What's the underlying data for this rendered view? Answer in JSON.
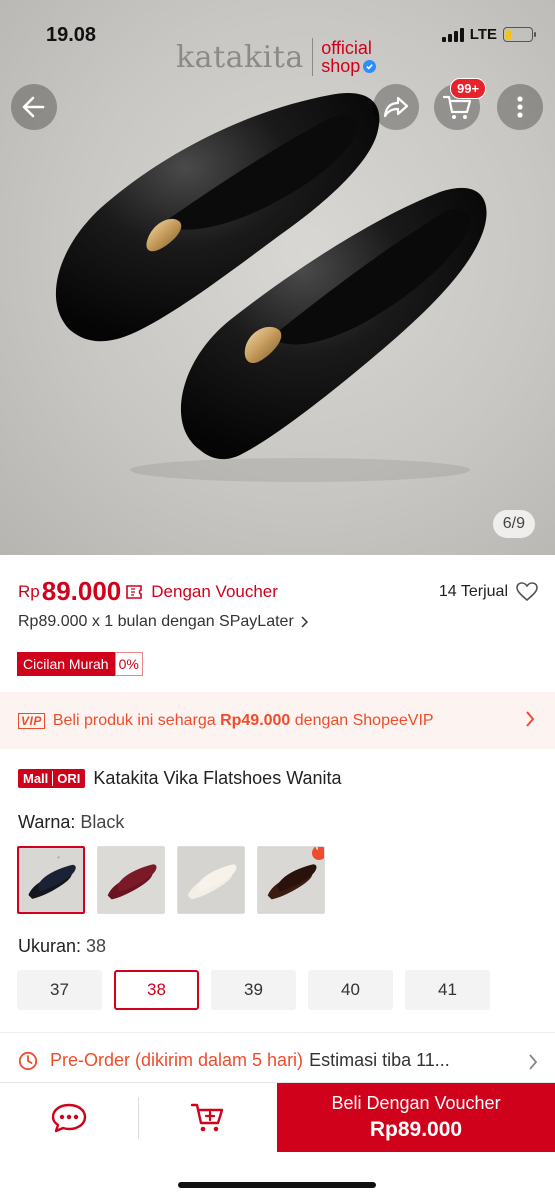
{
  "status_bar": {
    "time": "19.08",
    "network": "LTE",
    "battery_level": 0.2
  },
  "brand": {
    "name": "katakita",
    "official": "official",
    "shop": "shop"
  },
  "header": {
    "cart_badge": "99+",
    "image_counter": "6/9"
  },
  "price": {
    "currency": "Rp",
    "value": "89.000",
    "voucher_text": "Dengan Voucher",
    "sold": "14 Terjual",
    "spaylater": "Rp89.000 x 1 bulan dengan SPayLater",
    "cicilan_label": "Cicilan Murah",
    "cicilan_rate": "0%"
  },
  "vip": {
    "badge": "VIP",
    "text_before": "Beli produk ini seharga ",
    "text_price": "Rp49.000",
    "text_after": " dengan ShopeeVIP"
  },
  "product": {
    "badge_mall": "Mall",
    "badge_ori": "ORI",
    "title": "Katakita Vika Flatshoes Wanita"
  },
  "color": {
    "label": "Warna:",
    "selected": "Black",
    "options": [
      "black",
      "maroon",
      "cream",
      "brown"
    ]
  },
  "size": {
    "label": "Ukuran:",
    "selected": "38",
    "options": [
      "37",
      "38",
      "39",
      "40",
      "41"
    ]
  },
  "preorder": {
    "main": "Pre-Order (dikirim dalam 5 hari)",
    "estimate": "Estimasi tiba 11..."
  },
  "bottom": {
    "buy_label": "Beli Dengan Voucher",
    "buy_price": "Rp89.000"
  },
  "colors": {
    "accent": "#d0011b",
    "orange": "#ee4d2d"
  },
  "icons": [
    "back-arrow-icon",
    "share-icon",
    "cart-icon",
    "more-vertical-icon",
    "heart-icon",
    "voucher-icon",
    "clock-icon",
    "chat-icon",
    "add-to-cart-icon",
    "chevron-right-icon",
    "verified-icon",
    "fire-icon"
  ]
}
